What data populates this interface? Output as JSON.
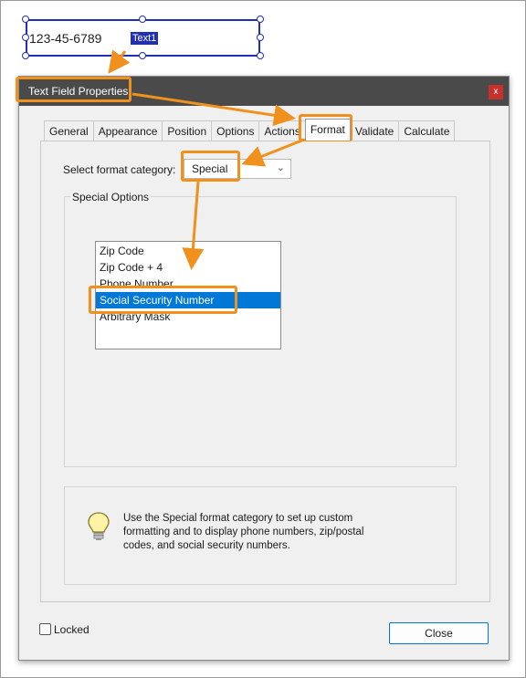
{
  "form_field": {
    "value": "123-45-6789",
    "name_tag": "Text1"
  },
  "dialog": {
    "title": "Text Field Properties",
    "close_x": "x",
    "tabs": [
      {
        "label": "General"
      },
      {
        "label": "Appearance"
      },
      {
        "label": "Position"
      },
      {
        "label": "Options"
      },
      {
        "label": "Actions"
      },
      {
        "label": "Format"
      },
      {
        "label": "Validate"
      },
      {
        "label": "Calculate"
      }
    ],
    "active_tab": "Format",
    "category_label": "Select format category:",
    "category_value": "Special",
    "special_options_label": "Special Options",
    "options": [
      {
        "label": "Zip Code"
      },
      {
        "label": "Zip Code + 4"
      },
      {
        "label": "Phone Number"
      },
      {
        "label": "Social Security Number"
      },
      {
        "label": "Arbitrary Mask"
      }
    ],
    "selected_option": "Social Security Number",
    "info_text": "Use the Special format category to set up custom formatting and to display phone numbers, zip/postal codes, and social security numbers.",
    "locked_label": "Locked",
    "locked_checked": false,
    "close_button": "Close"
  },
  "colors": {
    "callout": "#f0911d",
    "selection": "#0078d7",
    "field_border": "#1f2fb8",
    "titlebar": "#4a4a4a"
  },
  "icons": {
    "info": "lightbulb-icon",
    "dropdown": "chevron-down-icon"
  }
}
